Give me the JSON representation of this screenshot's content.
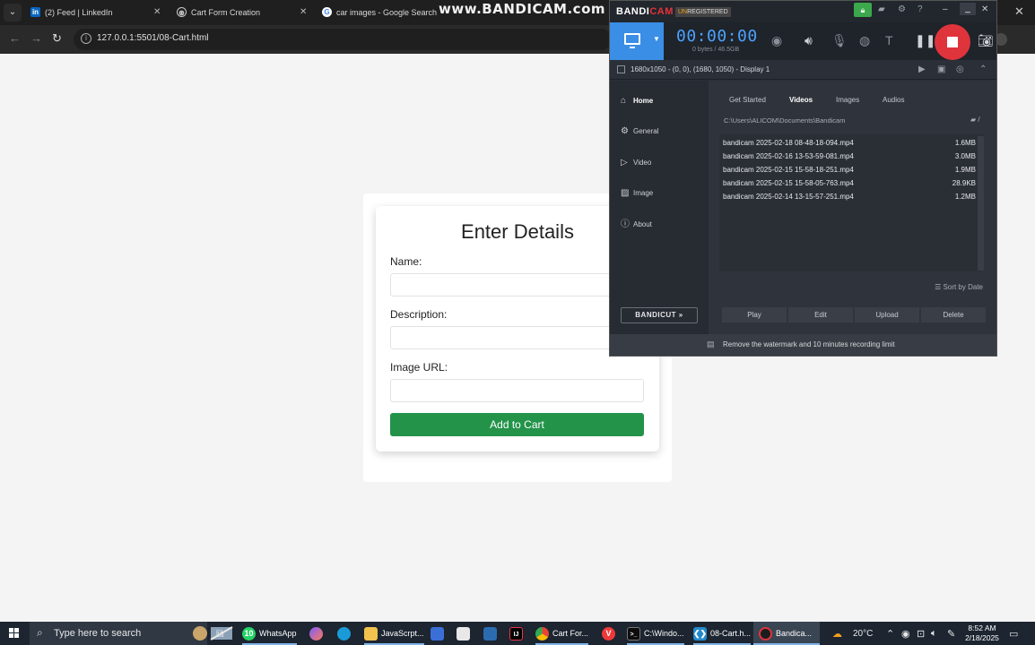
{
  "browser": {
    "tabs": [
      {
        "title": "(2) Feed | LinkedIn",
        "icon": "linkedin-icon"
      },
      {
        "title": "Cart Form Creation",
        "icon": "chatgpt-icon"
      },
      {
        "title": "car images - Google Search",
        "icon": "google-icon"
      }
    ],
    "watermark": "www.BANDICAM.com",
    "url": "127.0.0.1:5501/08-Cart.html"
  },
  "form": {
    "title": "Enter Details",
    "name_label": "Name:",
    "description_label": "Description:",
    "image_label": "Image URL:",
    "submit_label": "Add to Cart",
    "button_color": "#23934a"
  },
  "bandicam": {
    "logo_left": "BANDI",
    "logo_right": "CAM",
    "unregistered_un": "UN",
    "unregistered_rest": "REGISTERED",
    "timer": "00:00:00",
    "bytes": "0 bytes / 46.5GB",
    "area_info": "1680x1050 - (0, 0), (1680, 1050) - Display 1",
    "sidebar": [
      {
        "label": "Home",
        "icon": "home-icon"
      },
      {
        "label": "General",
        "icon": "gear-icon"
      },
      {
        "label": "Video",
        "icon": "video-icon"
      },
      {
        "label": "Image",
        "icon": "image-icon"
      },
      {
        "label": "About",
        "icon": "info-icon"
      }
    ],
    "tabs": [
      "Get Started",
      "Videos",
      "Images",
      "Audios"
    ],
    "path": "C:\\Users\\ALICOM\\Documents\\Bandicam",
    "files": [
      {
        "name": "bandicam 2025-02-18 08-48-18-094.mp4",
        "size": "1.6MB"
      },
      {
        "name": "bandicam 2025-02-16 13-53-59-081.mp4",
        "size": "3.0MB"
      },
      {
        "name": "bandicam 2025-02-15 15-58-18-251.mp4",
        "size": "1.9MB"
      },
      {
        "name": "bandicam 2025-02-15 15-58-05-763.mp4",
        "size": "28.9KB"
      },
      {
        "name": "bandicam 2025-02-14 13-15-57-251.mp4",
        "size": "1.2MB"
      }
    ],
    "sort_label": "Sort by Date",
    "bandicut": "BANDICUT",
    "actions": [
      "Play",
      "Edit",
      "Upload",
      "Delete"
    ],
    "footer": "Remove the watermark and 10 minutes recording limit",
    "record_color": "#e0343c",
    "accent_color": "#3a8ee6"
  },
  "taskbar": {
    "search_placeholder": "Type here to search",
    "apps": [
      {
        "label": "WhatsApp",
        "badge": "10"
      },
      {
        "label": "JavaScrpt..."
      },
      {
        "label": "Cart For..."
      },
      {
        "label": "C:\\Windo..."
      },
      {
        "label": "08-Cart.h..."
      },
      {
        "label": "Bandica..."
      }
    ],
    "temperature": "20°C",
    "time": "8:52 AM",
    "date": "2/18/2025"
  }
}
